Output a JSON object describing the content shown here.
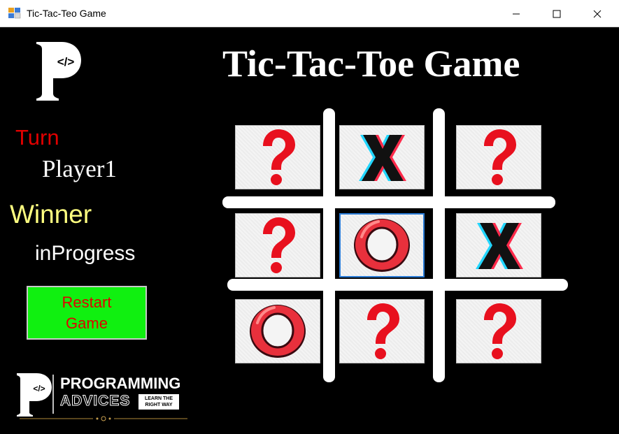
{
  "window": {
    "title": "Tic-Tac-Teo Game"
  },
  "logo": {
    "letter": "P",
    "glyph": "</>"
  },
  "status": {
    "turn_label": "Turn",
    "turn_value": "Player1",
    "winner_label": "Winner",
    "winner_value": "inProgress"
  },
  "restart": {
    "label": "Restart Game"
  },
  "brand": {
    "letter": "P",
    "name": "PROGRAMMING",
    "sub": "ADVICES",
    "tag_line1": "LEARN THE",
    "tag_line2": "RIGHT WAY"
  },
  "game": {
    "title": "Tic-Tac-Toe Game"
  },
  "board": [
    [
      "?",
      "X",
      "?"
    ],
    [
      "?",
      "O",
      "X"
    ],
    [
      "O",
      "?",
      "?"
    ]
  ],
  "colors": {
    "turn_label": "#e00000",
    "winner_label": "#ffff80",
    "restart_bg": "#10f010",
    "restart_text": "#e00000",
    "question_mark": "#e8101e",
    "o_mark": "#e8303c",
    "x_mark": "#111111"
  }
}
